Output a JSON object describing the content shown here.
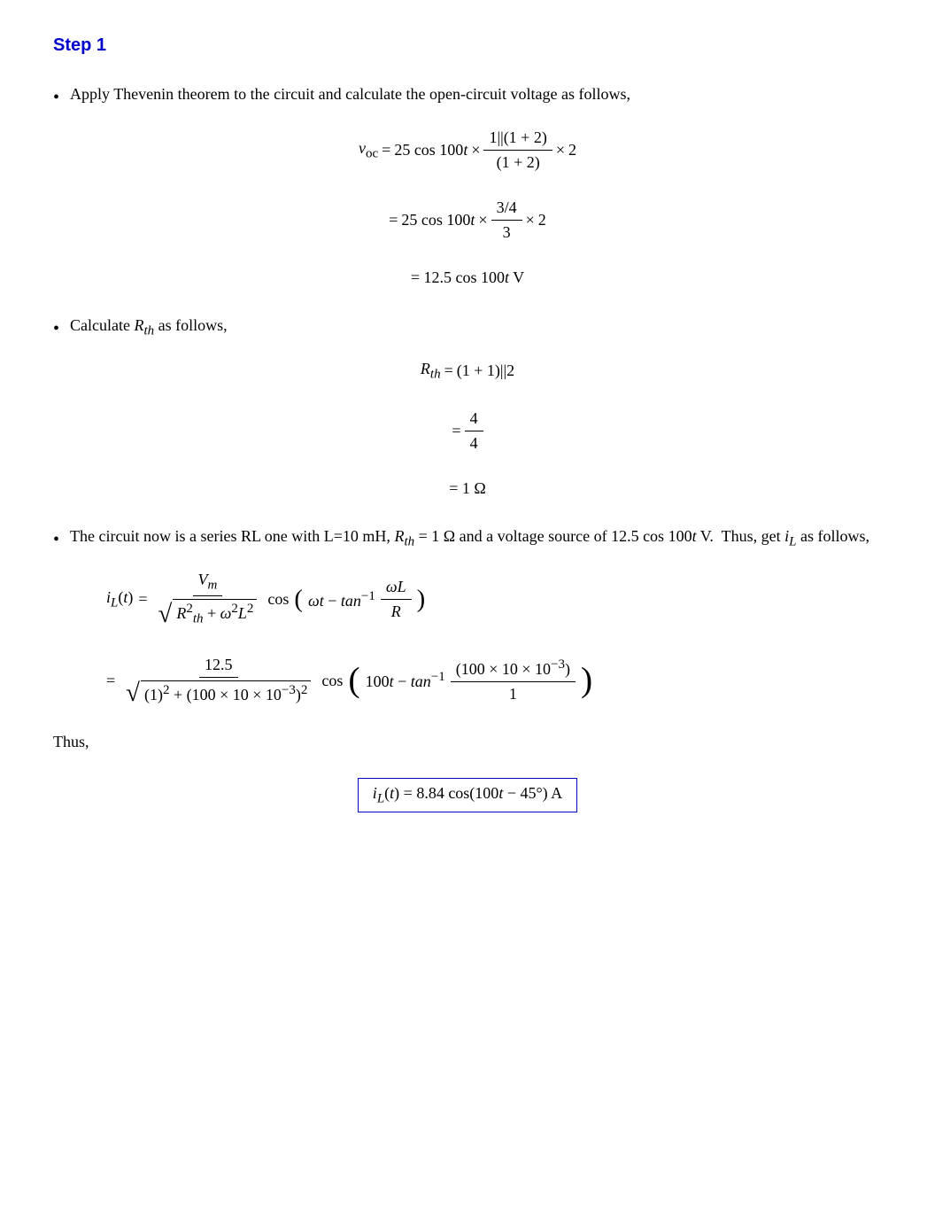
{
  "page": {
    "step_heading": "Step 1",
    "bullet1": {
      "text": "Apply Thevenin theorem to the circuit and calculate the open-circuit voltage as follows,"
    },
    "bullet2": {
      "text": "Calculate "
    },
    "bullet2b": {
      "text": " as follows,"
    },
    "bullet3": {
      "text1": "The circuit now is a series RL one with L=10 mH, ",
      "text2": " = 1 Ω and a voltage source of 12.5 cos 100",
      "text3": " V.  Thus, get ",
      "text4": " as follows,"
    },
    "thus_text": "Thus,",
    "final_result": "i",
    "final_result2": "L",
    "final_result3": "(t) = 8.84 cos(100t − 45°) A"
  }
}
